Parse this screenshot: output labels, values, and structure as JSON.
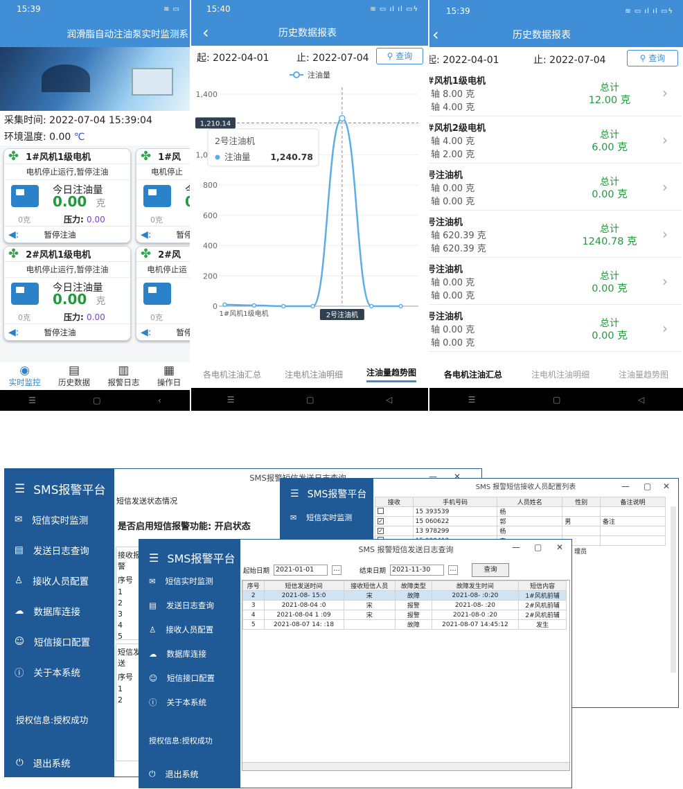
{
  "phone1": {
    "time": "15:39",
    "title": "润滑脂自动注油泵实时监测系",
    "collect_label": "采集时间: 2022-07-04 15:39:04",
    "temp_label": "环境温度: ",
    "temp_value": "0.00",
    "temp_unit": "℃",
    "cards": [
      {
        "title": "1#风机1级电机",
        "status": "电机停止运行,暂停注油",
        "today_label": "今日注油量",
        "today_value": "0.00",
        "unit": "克",
        "small": "0克",
        "pressure_label": "压力:",
        "pressure_value": "0.00",
        "pause": "暂停注油"
      },
      {
        "title": "1#风",
        "status": "电机停止",
        "today_label": "今",
        "today_value": "0",
        "unit": "",
        "small": "0克",
        "pressure_label": "",
        "pressure_value": "",
        "pause": "暂停"
      },
      {
        "title": "2#风机1级电机",
        "status": "电机停止运行,暂停注油",
        "today_label": "今日注油量",
        "today_value": "0.00",
        "unit": "克",
        "small": "0克",
        "pressure_label": "压力:",
        "pressure_value": "0.00",
        "pause": "暂停注油"
      },
      {
        "title": "2#风",
        "status": "电机停止运",
        "today_label": "",
        "today_value": "",
        "unit": "",
        "small": "0克",
        "pressure_label": "",
        "pressure_value": "",
        "pause": "暂停"
      }
    ],
    "tabs": [
      {
        "label": "实时监控",
        "icon": "eye-icon",
        "active": true
      },
      {
        "label": "历史数据",
        "icon": "history-icon",
        "active": false
      },
      {
        "label": "报警日志",
        "icon": "alarm-log-icon",
        "active": false
      },
      {
        "label": "操作日",
        "icon": "operation-log-icon",
        "active": false
      }
    ]
  },
  "phone2": {
    "time": "15:40",
    "title": "历史数据报表",
    "start_label": "起:",
    "start": "2022-04-01",
    "end_label": "止:",
    "end": "2022-07-04",
    "query": "查询",
    "tabs": [
      "各电机注油汇总",
      "注电机注油明细",
      "注油量趋势图"
    ],
    "active_tab": 2,
    "chart_data": {
      "type": "line",
      "legend": "注油量",
      "x": [
        "1#风机1级电机",
        "",
        "",
        "",
        "2号注油机",
        "",
        ""
      ],
      "values": [
        10,
        5,
        0,
        0,
        1240.78,
        0,
        0
      ],
      "ylim": [
        0,
        1400
      ],
      "yticks": [
        "0",
        "200",
        "400",
        "600",
        "800",
        "1,000",
        "1,200",
        "1,400"
      ],
      "crosshair_label": "1,210.14",
      "tooltip": {
        "title": "2号注油机",
        "series": "注油量",
        "value": "1,240.78"
      },
      "x_highlight": "2号注油机"
    }
  },
  "phone3": {
    "time": "15:39",
    "title": "历史数据报表",
    "start_label": "起:",
    "start": "2022-04-01",
    "end_label": "止:",
    "end": "2022-07-04",
    "query": "查询",
    "rows": [
      {
        "name": "#风机1级电机",
        "l1": "轴  8.00 克",
        "l2": "轴  4.00 克",
        "total_label": "总计",
        "total": "12.00 克"
      },
      {
        "name": "#风机2级电机",
        "l1": "轴  4.00 克",
        "l2": "轴  2.00 克",
        "total_label": "总计",
        "total": "6.00 克"
      },
      {
        "name": "号注油机",
        "l1": "轴  0.00 克",
        "l2": "轴  0.00 克",
        "total_label": "总计",
        "total": "0.00 克"
      },
      {
        "name": "号注油机",
        "l1": "轴  620.39 克",
        "l2": "轴  620.39 克",
        "total_label": "总计",
        "total": "1240.78 克"
      },
      {
        "name": "号注油机",
        "l1": "轴  0.00 克",
        "l2": "轴  0.00 克",
        "total_label": "总计",
        "total": "0.00 克"
      },
      {
        "name": "号注油机",
        "l1": "轴  0.00 克",
        "l2": "轴  0.00 克",
        "total_label": "总计",
        "total": "0.00 克"
      }
    ],
    "tabs": [
      "各电机注油汇总",
      "注电机注油明细",
      "注油量趋势图"
    ]
  },
  "desktop": {
    "brand": "SMS报警平台",
    "menu": [
      "短信实时监测",
      "发送日志查询",
      "接收人员配置",
      "数据库连接",
      "短信接口配置",
      "关于本系统"
    ],
    "license": "授权信息:授权成功",
    "exit": "退出系统",
    "back_window": {
      "title": "SMS报警短信发送日志查询",
      "section": "短信发送状态情况",
      "enable_text": "是否启用短信报警功能: 开启状态",
      "sub1": "接收报警",
      "seq_label": "序号",
      "seq": [
        "1",
        "2",
        "3",
        "4",
        "5"
      ],
      "sub2": "短信发送",
      "seq2": [
        "1",
        "2"
      ]
    },
    "recv_window": {
      "title": "SMS 报警短信接收人员配置列表",
      "headers": [
        "接收",
        "手机号码",
        "人员姓名",
        "性别",
        "备注说明"
      ],
      "rows": [
        {
          "check": "",
          "phone": "15  393539",
          "name": "杨",
          "gender": "",
          "note": ""
        },
        {
          "check": "✓",
          "phone": "15  060622",
          "name": "郭",
          "gender": "男",
          "note": "备注"
        },
        {
          "check": "✓",
          "phone": "13  978299",
          "name": "杨",
          "gender": "",
          "note": ""
        },
        {
          "check": "",
          "phone": "15  999412",
          "name": "宙",
          "gender": "",
          "note": ""
        }
      ],
      "extra": "理员"
    },
    "log_window": {
      "title": "SMS 报警短信发送日志查询",
      "start_label": "起始日期",
      "start": "2021-01-01",
      "end_label": "结束日期",
      "end": "2021-11-30",
      "query": "查询",
      "headers": [
        "序号",
        "短信发送时间",
        "接收短信人员",
        "故障类型",
        "故障发生时间",
        "短信内容"
      ],
      "rows": [
        {
          "seq": "2",
          "send": "2021-08-  15:0",
          "recv": "宋",
          "type": "故障",
          "time": "2021-08-    :0:20",
          "content": "1#风机前辅"
        },
        {
          "seq": "3",
          "send": "2021-08-04    :0",
          "recv": "宋",
          "type": "报警",
          "time": "2021-08-     :20",
          "content": "2#风机前辅"
        },
        {
          "seq": "4",
          "send": "2021-08-04 1    :09",
          "recv": "宋",
          "type": "报警",
          "time": "2021-08-0   :20",
          "content": "2#风机前辅"
        },
        {
          "seq": "5",
          "send": "2021-08-07 14:  :18",
          "recv": "",
          "type": "故障",
          "time": "2021-08-07 14:45:12",
          "content": "发生"
        }
      ]
    }
  }
}
